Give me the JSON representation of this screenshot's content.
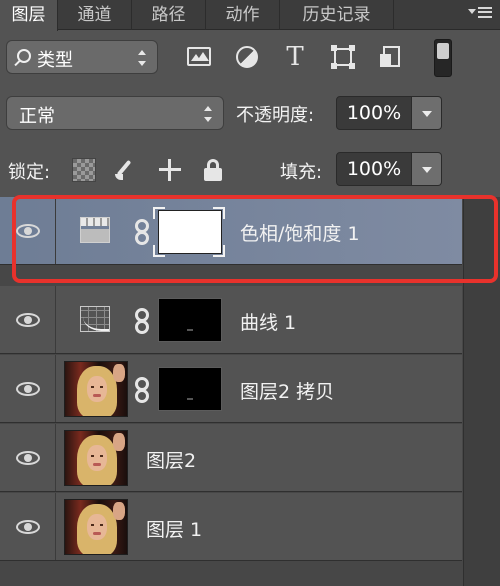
{
  "tabs": [
    {
      "label": "图层",
      "active": true
    },
    {
      "label": "通道",
      "active": false
    },
    {
      "label": "路径",
      "active": false
    },
    {
      "label": "动作",
      "active": false
    },
    {
      "label": "历史记录",
      "active": false
    }
  ],
  "filter": {
    "kind_label": "类型",
    "icons": [
      "image-filter-icon",
      "adjustment-filter-icon",
      "type-filter-icon",
      "shape-filter-icon",
      "smart-object-filter-icon"
    ]
  },
  "blend": {
    "mode": "正常",
    "opacity_label": "不透明度:",
    "opacity_value": "100%"
  },
  "lock": {
    "label": "锁定:",
    "fill_label": "填充:",
    "fill_value": "100%"
  },
  "layers": [
    {
      "name": "色相/饱和度 1",
      "type": "hue-saturation",
      "mask": "white",
      "selected": true,
      "visible": true
    },
    {
      "name": "曲线 1",
      "type": "curves",
      "mask": "black",
      "selected": false,
      "visible": true
    },
    {
      "name": "图层2 拷贝",
      "type": "pixel",
      "mask": "black",
      "selected": false,
      "visible": true
    },
    {
      "name": "图层2",
      "type": "pixel",
      "mask": null,
      "selected": false,
      "visible": true
    },
    {
      "name": "图层 1",
      "type": "pixel",
      "mask": null,
      "selected": false,
      "visible": true
    }
  ],
  "colors": {
    "selection": "#7f8ba2",
    "highlight_border": "#e8322c",
    "panel": "#535353"
  }
}
